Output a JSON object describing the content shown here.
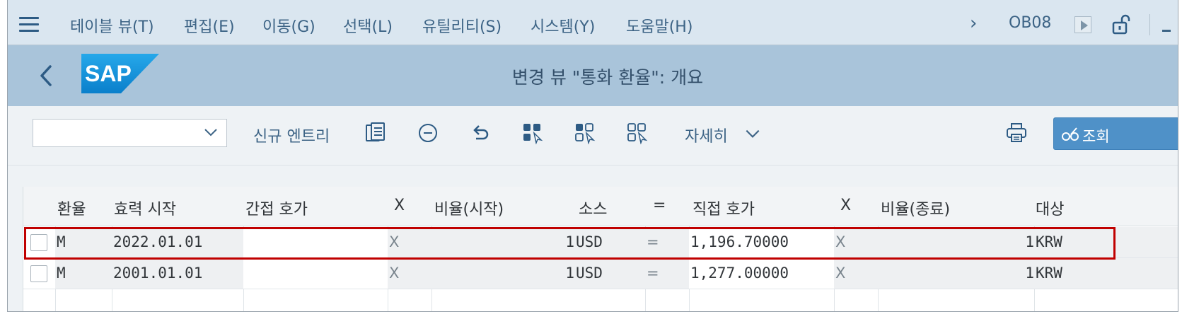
{
  "menu": {
    "items": [
      "테이블 뷰(T)",
      "편집(E)",
      "이동(G)",
      "선택(L)",
      "유틸리티(S)",
      "시스템(Y)",
      "도움말(H)"
    ],
    "tcode": "OB08"
  },
  "shell": {
    "logo_text": "SAP",
    "title": "변경 뷰 \"통화 환율\": 개요"
  },
  "toolbar": {
    "dropdown_value": "",
    "new_entries": "신규 엔트리",
    "details": "자세히",
    "view_button": "조회"
  },
  "table": {
    "headers": [
      "환율",
      "효력 시작",
      "간접 호가",
      "X",
      "비율(시작)",
      "소스",
      "=",
      "직접 호가",
      "X",
      "비율(종료)",
      "대상"
    ],
    "rows": [
      {
        "type": "M",
        "valid_from": "2022.01.01",
        "indirect": "",
        "x1": "X",
        "ratio_from": "1",
        "from_cur": "USD",
        "eq": "=",
        "direct": "1,196.70000",
        "x2": "X",
        "ratio_to": "1",
        "to_cur": "KRW",
        "highlighted": true
      },
      {
        "type": "M",
        "valid_from": "2001.01.01",
        "indirect": "",
        "x1": "X",
        "ratio_from": "1",
        "from_cur": "USD",
        "eq": "=",
        "direct": "1,277.00000",
        "x2": "X",
        "ratio_to": "1",
        "to_cur": "KRW",
        "highlighted": false
      }
    ]
  },
  "colors": {
    "menubar": "#dae6f0",
    "shell": "#a9c4da",
    "sap_blue": "#1a9fe0",
    "highlight": "#c00000",
    "button": "#4f91c8"
  }
}
